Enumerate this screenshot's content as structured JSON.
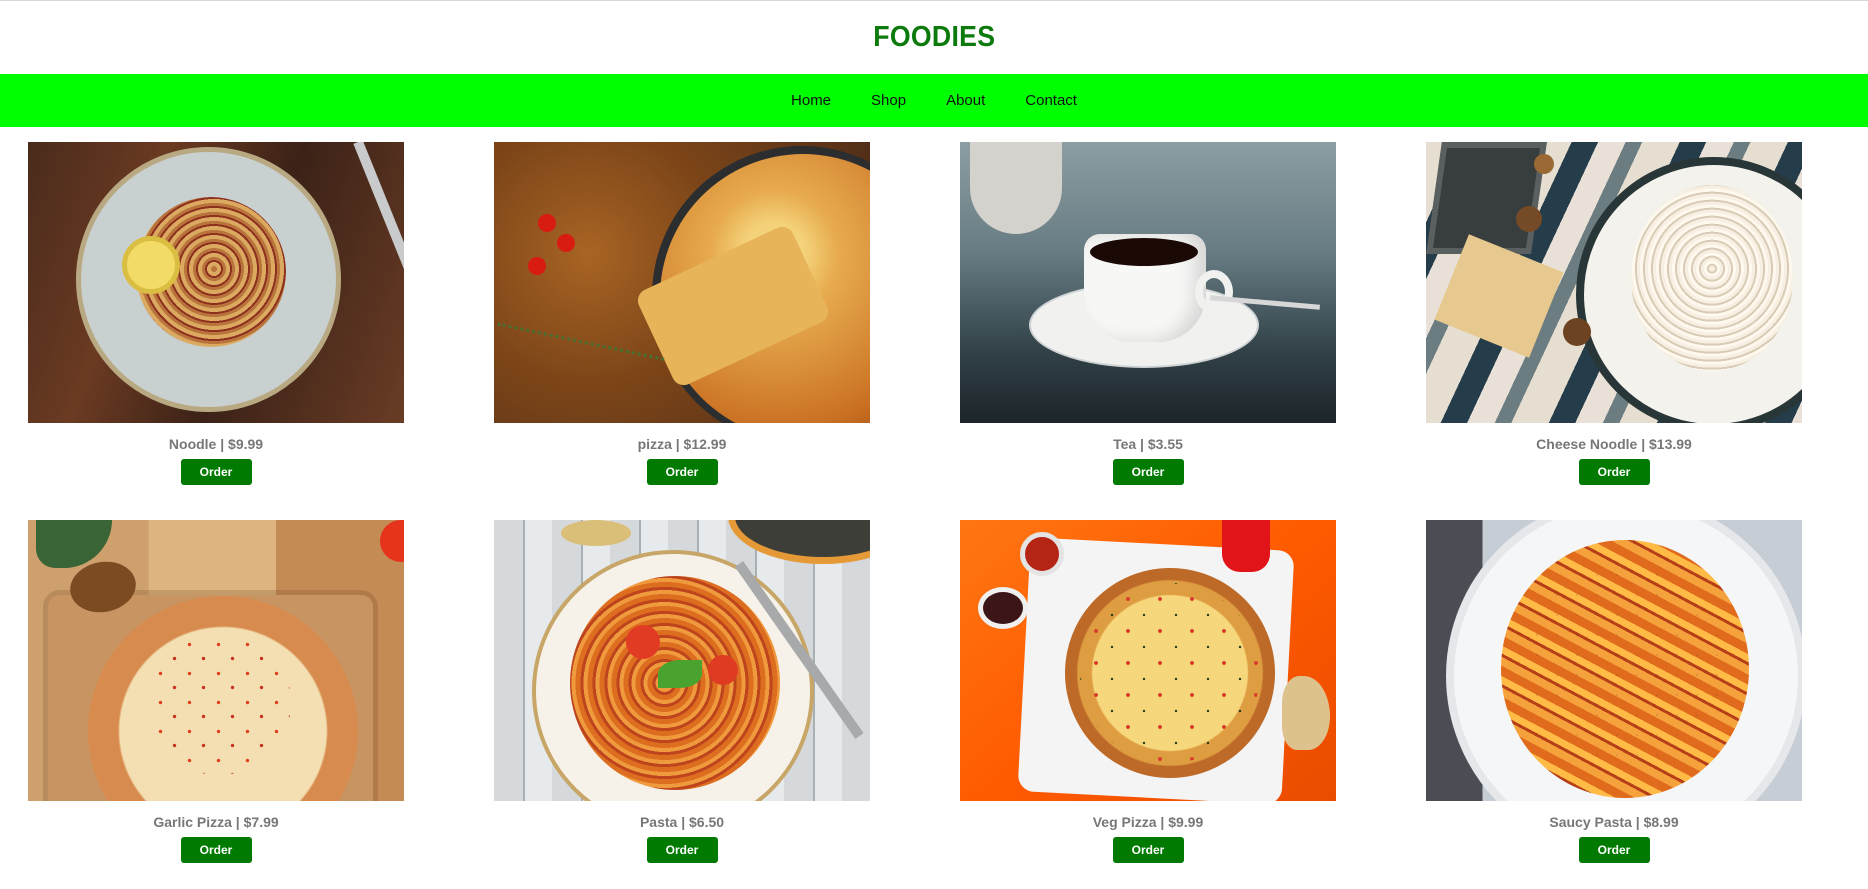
{
  "header": {
    "title": "FOODIES"
  },
  "nav": {
    "items": [
      {
        "label": "Home"
      },
      {
        "label": "Shop"
      },
      {
        "label": "About"
      },
      {
        "label": "Contact"
      }
    ]
  },
  "colors": {
    "brand": "#0c7a0c",
    "nav_background": "#00ff00",
    "button": "#007a00"
  },
  "products": [
    {
      "name": "Noodle",
      "price": "$9.99",
      "caption": "Noodle | $9.99",
      "order_label": "Order"
    },
    {
      "name": "pizza",
      "price": "$12.99",
      "caption": "pizza | $12.99",
      "order_label": "Order"
    },
    {
      "name": "Tea",
      "price": "$3.55",
      "caption": "Tea | $3.55",
      "order_label": "Order"
    },
    {
      "name": "Cheese Noodle",
      "price": "$13.99",
      "caption": "Cheese Noodle | $13.99",
      "order_label": "Order"
    },
    {
      "name": "Garlic Pizza",
      "price": "$7.99",
      "caption": "Garlic Pizza | $7.99",
      "order_label": "Order"
    },
    {
      "name": "Pasta",
      "price": "$6.50",
      "caption": "Pasta | $6.50",
      "order_label": "Order"
    },
    {
      "name": "Veg Pizza",
      "price": "$9.99",
      "caption": "Veg Pizza | $9.99",
      "order_label": "Order"
    },
    {
      "name": "Saucy Pasta",
      "price": "$8.99",
      "caption": "Saucy Pasta | $8.99",
      "order_label": "Order"
    }
  ]
}
